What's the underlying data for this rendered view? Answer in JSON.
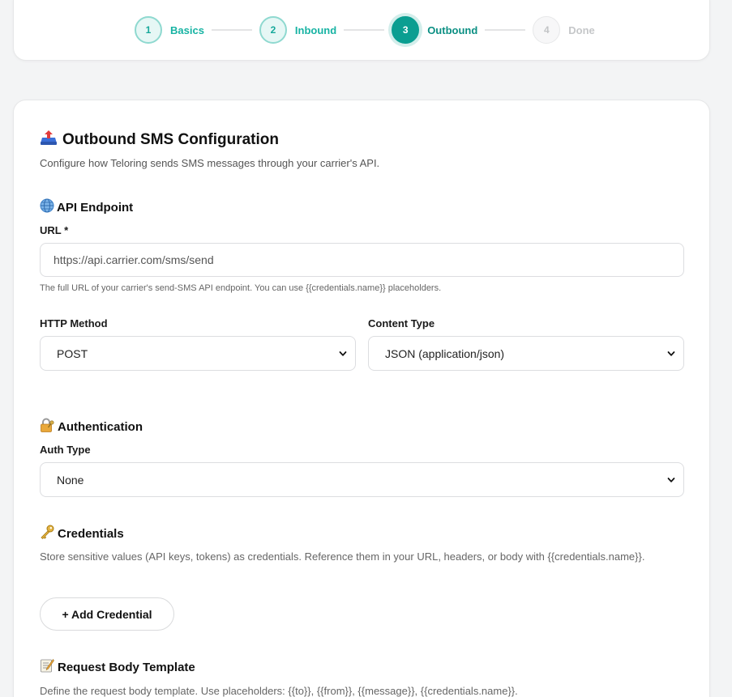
{
  "stepper": {
    "steps": [
      {
        "number": "1",
        "label": "Basics"
      },
      {
        "number": "2",
        "label": "Inbound"
      },
      {
        "number": "3",
        "label": "Outbound"
      },
      {
        "number": "4",
        "label": "Done"
      }
    ]
  },
  "page": {
    "title": "Outbound SMS Configuration",
    "subtitle": "Configure how Teloring sends SMS messages through your carrier's API."
  },
  "api_endpoint": {
    "title": "API Endpoint",
    "url_label": "URL *",
    "url_placeholder": "https://api.carrier.com/sms/send",
    "url_hint": "The full URL of your carrier's send-SMS API endpoint. You can use {{credentials.name}} placeholders.",
    "method_label": "HTTP Method",
    "method_value": "POST",
    "content_type_label": "Content Type",
    "content_type_value": "JSON (application/json)"
  },
  "authentication": {
    "title": "Authentication",
    "auth_type_label": "Auth Type",
    "auth_type_value": "None"
  },
  "credentials": {
    "title": "Credentials",
    "description": "Store sensitive values (API keys, tokens) as credentials. Reference them in your URL, headers, or body with {{credentials.name}}.",
    "add_button": "+ Add Credential"
  },
  "request_body": {
    "title": "Request Body Template",
    "description": "Define the request body template. Use placeholders: {{to}}, {{from}}, {{message}}, {{credentials.name}}."
  },
  "icons": {
    "title_icon": "outbox-tray-icon",
    "endpoint_icon": "globe-icon",
    "auth_icon": "lock-with-key-icon",
    "credentials_icon": "key-icon",
    "body_icon": "memo-icon"
  },
  "colors": {
    "accent": "#0b9e91",
    "accent_light": "#17b3a3",
    "pending": "#c5c7c9"
  }
}
